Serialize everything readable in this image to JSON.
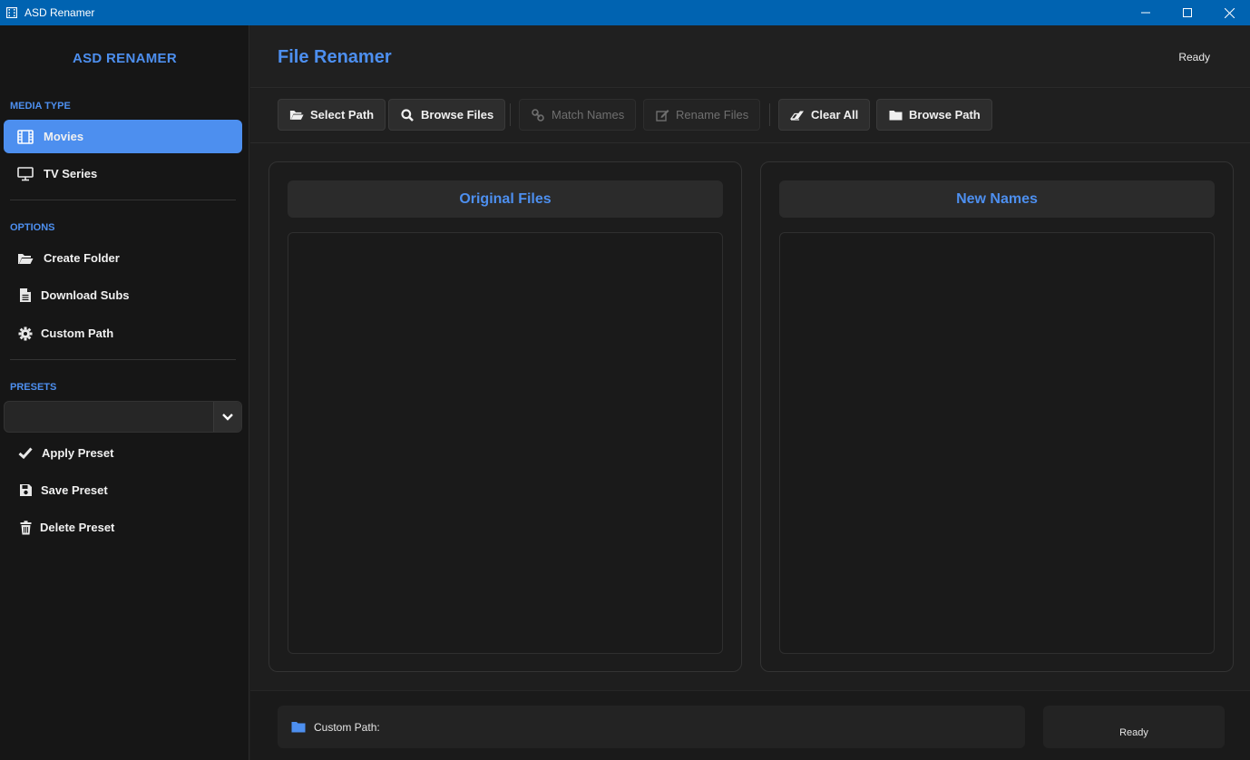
{
  "window": {
    "title": "ASD Renamer"
  },
  "sidebar": {
    "brand": "ASD RENAMER",
    "media_type_label": "MEDIA TYPE",
    "media_items": [
      {
        "label": "Movies",
        "icon": "film-icon",
        "active": true
      },
      {
        "label": "TV Series",
        "icon": "monitor-icon",
        "active": false
      }
    ],
    "options_label": "OPTIONS",
    "option_items": [
      {
        "label": "Create Folder",
        "icon": "folder-open-icon"
      },
      {
        "label": "Download Subs",
        "icon": "document-icon"
      },
      {
        "label": "Custom Path",
        "icon": "gear-icon"
      }
    ],
    "presets_label": "PRESETS",
    "preset_select": {
      "value": ""
    },
    "preset_actions": [
      {
        "label": "Apply Preset",
        "icon": "check-icon"
      },
      {
        "label": "Save Preset",
        "icon": "floppy-icon"
      },
      {
        "label": "Delete Preset",
        "icon": "trash-icon"
      }
    ]
  },
  "header": {
    "title": "File Renamer",
    "status": "Ready"
  },
  "toolbar": {
    "buttons": [
      {
        "label": "Select Path",
        "icon": "folder-open-icon",
        "enabled": true
      },
      {
        "label": "Browse Files",
        "icon": "search-icon",
        "enabled": true
      },
      {
        "label": "Match Names",
        "icon": "link-icon",
        "enabled": false
      },
      {
        "label": "Rename Files",
        "icon": "edit-icon",
        "enabled": false
      },
      {
        "label": "Clear All",
        "icon": "eraser-icon",
        "enabled": true
      },
      {
        "label": "Browse Path",
        "icon": "folder-icon",
        "enabled": true
      }
    ]
  },
  "panels": {
    "original": {
      "title": "Original Files",
      "items": []
    },
    "new_names": {
      "title": "New Names",
      "items": []
    }
  },
  "footer": {
    "custom_path_label": "Custom Path:",
    "status": "Ready"
  },
  "colors": {
    "accent": "#4d8fef",
    "titlebar": "#0063b1",
    "background": "#1e1e1e",
    "sidebar": "#161616"
  }
}
